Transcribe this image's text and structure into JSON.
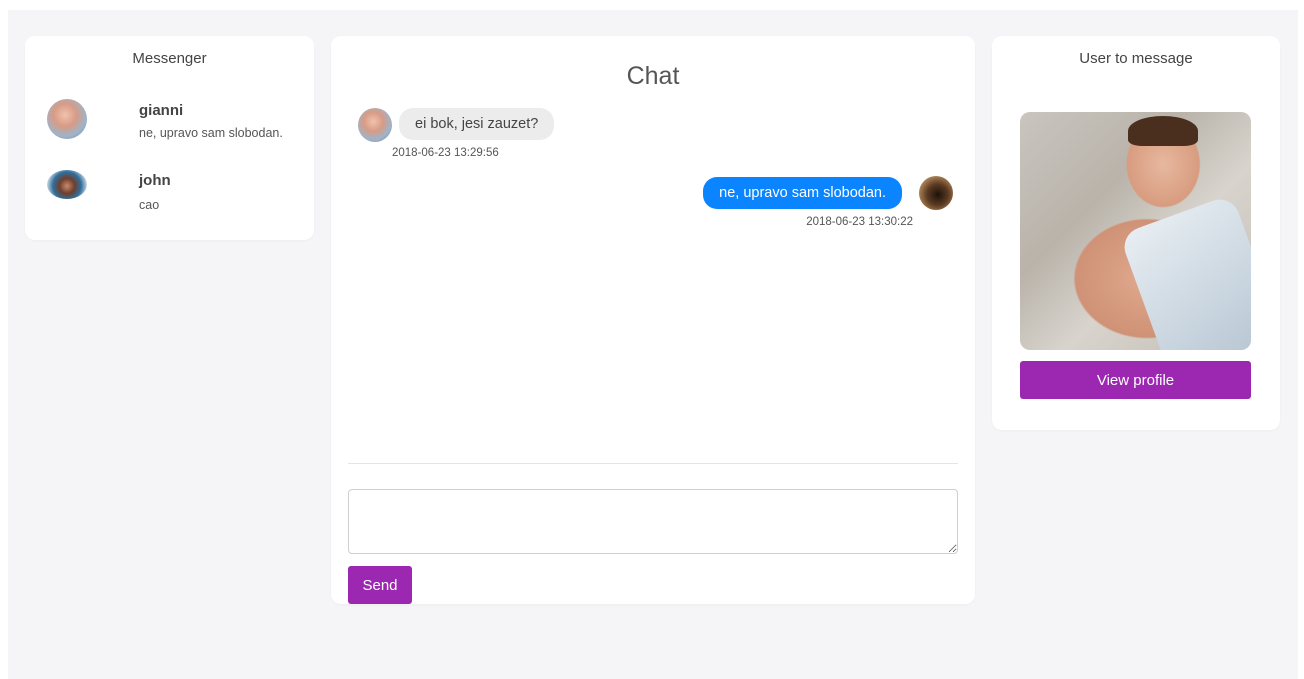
{
  "messenger": {
    "title": "Messenger",
    "conversations": [
      {
        "name": "gianni",
        "preview": "ne, upravo sam slobodan."
      },
      {
        "name": "john",
        "preview": "cao"
      }
    ]
  },
  "chat": {
    "title": "Chat",
    "messages": [
      {
        "direction": "incoming",
        "text": "ei bok, jesi zauzet?",
        "timestamp": "2018-06-23 13:29:56"
      },
      {
        "direction": "outgoing",
        "text": "ne, upravo sam slobodan.",
        "timestamp": "2018-06-23 13:30:22"
      }
    ],
    "composer": {
      "value": "",
      "placeholder": ""
    },
    "send_label": "Send"
  },
  "user_panel": {
    "title": "User to message",
    "view_profile_label": "View profile"
  },
  "colors": {
    "accent": "#9c27b0",
    "outgoing_bubble": "#0a84ff",
    "incoming_bubble": "#ececec",
    "page_background": "#f5f5f7"
  }
}
